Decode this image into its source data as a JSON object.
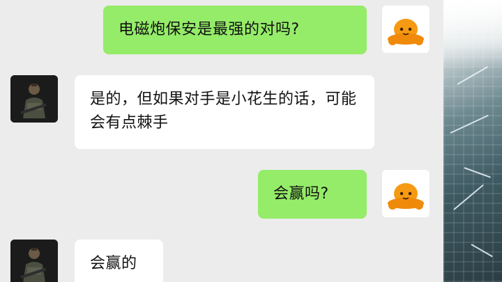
{
  "messages": [
    {
      "side": "right",
      "text": "电磁炮保安是最强的对吗?"
    },
    {
      "side": "left",
      "text": "是的，但如果对手是小花生的话，可能会有点棘手"
    },
    {
      "side": "right",
      "text": "会赢吗?"
    },
    {
      "side": "left",
      "text": "会赢的"
    }
  ],
  "colors": {
    "outgoing_bubble": "#95ec69",
    "incoming_bubble": "#ffffff",
    "chat_background": "#ececec"
  },
  "icons": {
    "my_avatar": "orange-octopus-avatar-icon",
    "contact_avatar": "soldier-photo-avatar-icon"
  }
}
